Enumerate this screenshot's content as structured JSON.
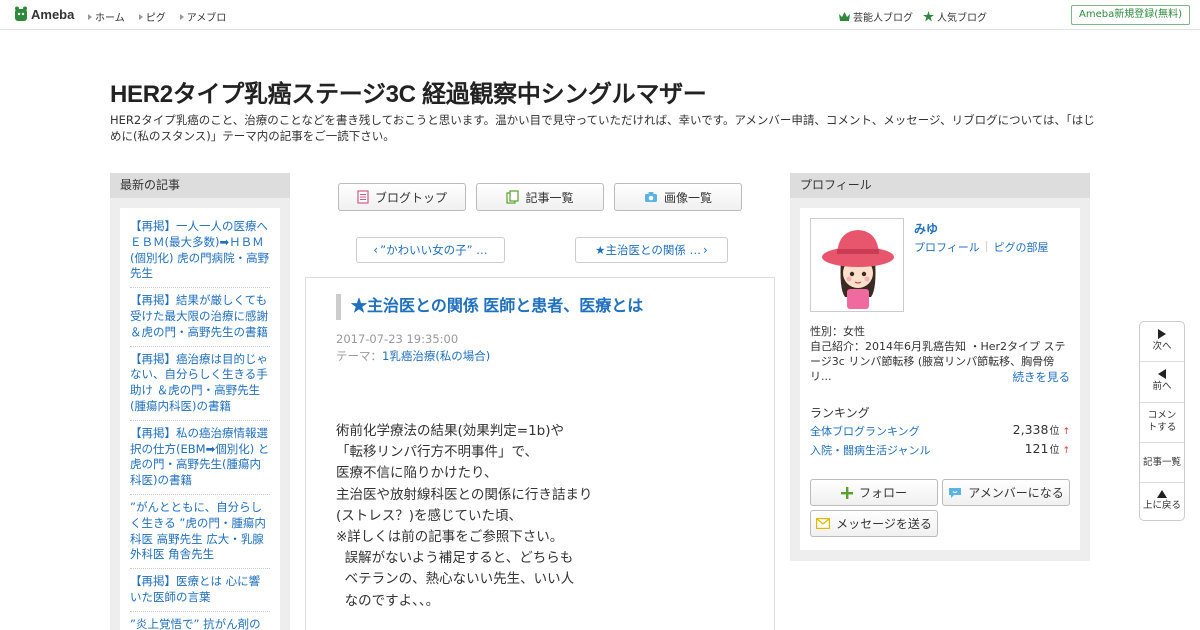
{
  "topbar": {
    "logo": "Ameba",
    "nav": [
      "ホーム",
      "ピグ",
      "アメブロ"
    ],
    "links": [
      "芸能人ブログ",
      "人気ブログ"
    ],
    "signup": "Ameba新規登録(無料)"
  },
  "header": {
    "title": "HER2タイプ乳癌ステージ3C 経過観察中シングルマザー",
    "description": "HER2タイプ乳癌のこと、治療のことなどを書き残しておこうと思います。温かい目で見守っていただければ、幸いです。アメンバー申請、コメント、メッセージ、リブログについては、「はじめに(私のスタンス)」テーマ内の記事をご一読下さい。"
  },
  "left_sidebar": {
    "heading": "最新の記事",
    "items": [
      "【再掲】一人一人の医療へ ＥＢＭ(最大多数)➡ＨＢＭ(個別化) 虎の門病院・高野先生",
      "【再掲】結果が厳しくても受けた最大限の治療に感謝 ＆虎の門・高野先生の書籍",
      "【再掲】癌治療は目的じゃない、自分らしく生きる手助け ＆虎の門・高野先生(腫瘍内科医)の書籍",
      "【再掲】私の癌治療情報選択の仕方(EBM➡個別化) と虎の門・高野先生(腫瘍内科医)の書籍",
      "”がんとともに、自分らしく生きる ”虎の門・腫瘍内科医 高野先生 広大・乳腺外科医 角舎先生",
      "【再掲】医療とは 心に響いた医師の言葉",
      "”炎上覚悟で” 抗がん剤の"
    ]
  },
  "center": {
    "buttons": {
      "top": "ブログトップ",
      "list": "記事一覧",
      "images": "画像一覧"
    },
    "pager": {
      "prev": "”かわいい女の子” …",
      "next": "★主治医との関係 …"
    },
    "article": {
      "title": "★主治医との関係 医師と患者、医療とは",
      "date": "2017-07-23 19:35:00",
      "theme_label": "テーマ：",
      "theme": "1乳癌治療(私の場合)",
      "body": "術前化学療法の結果(効果判定=1b)や\n「転移リンパ行方不明事件」で、\n医療不信に陥りかけたり、\n主治医や放射線科医との関係に行き詰まり\n(ストレス？)を感じていた頃、\n※詳しくは前の記事をご参照下さい。\n  誤解がないよう補足すると、どちらも\n  ベテランの、熱心ないい先生、いい人\n  なのですよ、、。"
    }
  },
  "profile": {
    "heading": "プロフィール",
    "name": "みゆ",
    "link_profile": "プロフィール",
    "link_pig": "ピグの部屋",
    "gender": "性別：女性",
    "intro": "自己紹介：2014年6月乳癌告知 ・Her2タイプ ステージ3c リンパ節転移 (腋窩リンパ節転移、胸骨傍リ...",
    "more": "続きを見る",
    "ranking_title": "ランキング",
    "rankings": [
      {
        "label": "全体ブログランキング",
        "value": "2,338",
        "unit": "位"
      },
      {
        "label": "入院・闘病生活ジャンル",
        "value": "121",
        "unit": "位"
      }
    ],
    "follow": "フォロー",
    "amember": "アメンバーになる",
    "message": "メッセージを送る"
  },
  "floatnav": {
    "next": "次へ",
    "prev": "前へ",
    "comment": "コメントする",
    "list": "記事一覧",
    "top": "上に戻る"
  },
  "colors": {
    "link": "#2070c0",
    "brand_green": "#2d8a3c"
  }
}
